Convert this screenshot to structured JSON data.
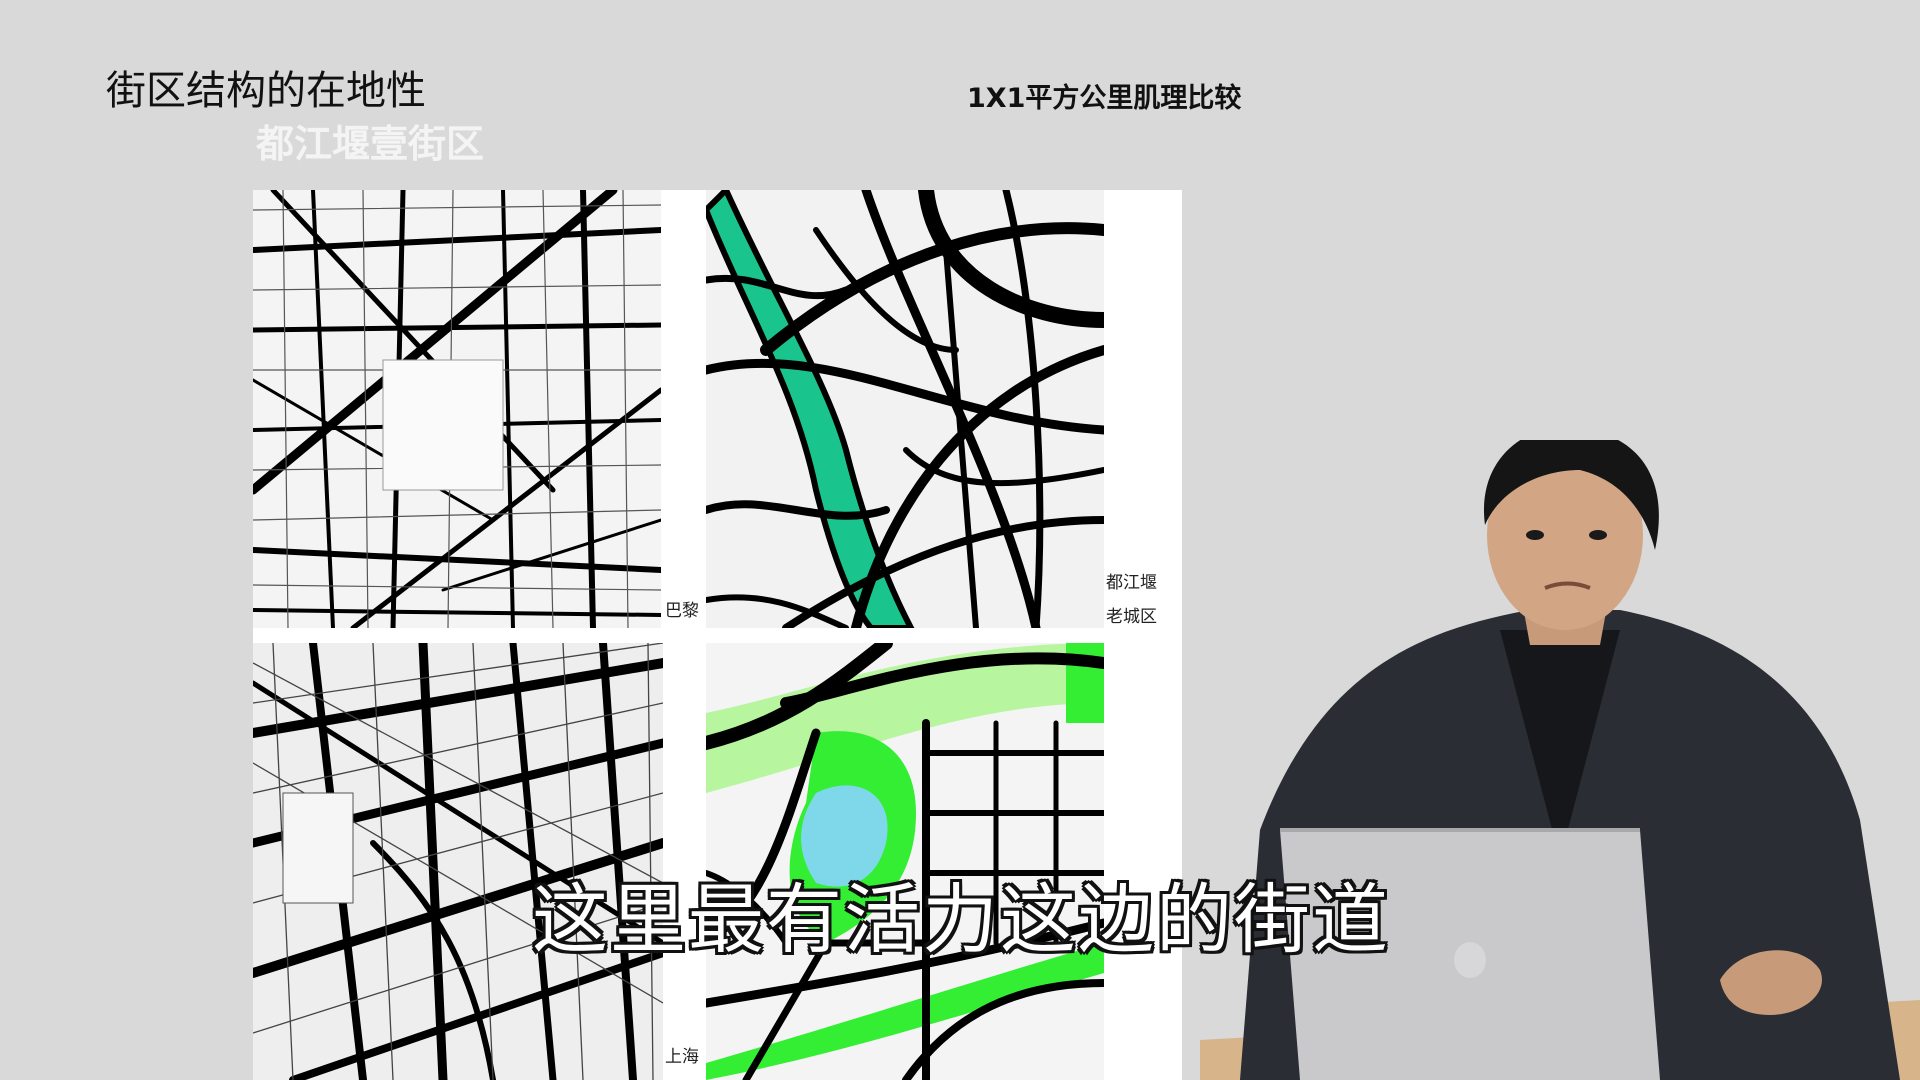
{
  "slide": {
    "title": "街区结构的在地性",
    "subtitle": "都江堰壹街区",
    "figure_title": "1X1平方公里肌理比较"
  },
  "maps": [
    {
      "labels": [
        "巴黎"
      ]
    },
    {
      "labels": [
        "都江堰",
        "老城区"
      ]
    },
    {
      "labels": [
        "上海"
      ]
    },
    {
      "labels": []
    }
  ],
  "caption": "这里最有活力这边的街道",
  "colors": {
    "background": "#d9d9d9",
    "road": "#000000",
    "river": "#19c58c",
    "park": "#33ee33"
  }
}
